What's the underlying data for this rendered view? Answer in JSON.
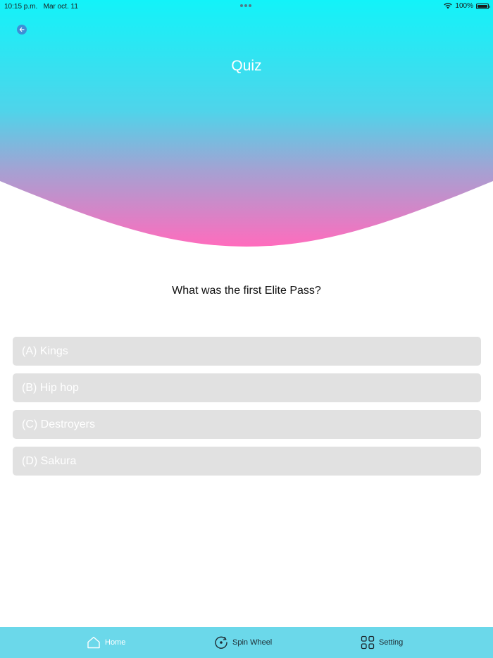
{
  "status_bar": {
    "time": "10:15 p.m.",
    "date": "Mar oct. 11",
    "battery": "100%",
    "wifi_icon": "wifi-icon",
    "battery_icon": "battery-icon"
  },
  "header": {
    "title": "Quiz",
    "back_icon": "arrow-left-icon",
    "gradient_top": "#12f3f9",
    "gradient_bottom": "#ff6cbd"
  },
  "quiz": {
    "question": "What was the first Elite Pass?",
    "options": [
      {
        "label": "(A) Kings"
      },
      {
        "label": "(B) Hip hop"
      },
      {
        "label": "(C) Destroyers"
      },
      {
        "label": "(D) Sakura"
      }
    ]
  },
  "tab_bar": {
    "background": "#6bd8ea",
    "tabs": [
      {
        "label": "Home",
        "icon": "home-icon",
        "active": true
      },
      {
        "label": "Spin Wheel",
        "icon": "spin-wheel-icon",
        "active": false
      },
      {
        "label": "Setting",
        "icon": "grid-icon",
        "active": false
      }
    ]
  }
}
